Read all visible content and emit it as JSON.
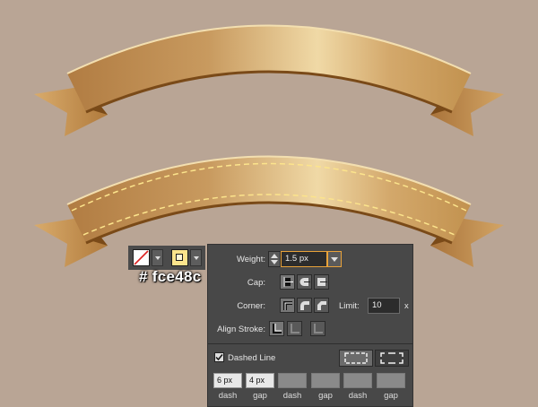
{
  "colors": {
    "background": "#b9a595",
    "ribbon_light": "#f0d9a6",
    "ribbon_mid": "#cfa56a",
    "ribbon_dark": "#a8753b",
    "ribbon_shadow": "#7a4a18",
    "stitch_color": "#fce48c",
    "panel_bg": "#484848"
  },
  "swatches": {
    "fill_icon": "none-fill-swatch",
    "stroke_color": "#fce48c"
  },
  "hex_label": "# fce48c",
  "stroke_panel": {
    "weight_label": "Weight:",
    "weight_value": "1.5 px",
    "cap_label": "Cap:",
    "corner_label": "Corner:",
    "limit_label": "Limit:",
    "limit_value": "10",
    "limit_unit": "x",
    "align_label": "Align Stroke:",
    "dashed_label": "Dashed Line",
    "dashed_checked": true,
    "dash_cells": [
      {
        "value": "6 px",
        "label": "dash"
      },
      {
        "value": "4 px",
        "label": "gap"
      },
      {
        "value": "",
        "label": "dash"
      },
      {
        "value": "",
        "label": "gap"
      },
      {
        "value": "",
        "label": "dash"
      },
      {
        "value": "",
        "label": "gap"
      }
    ]
  }
}
